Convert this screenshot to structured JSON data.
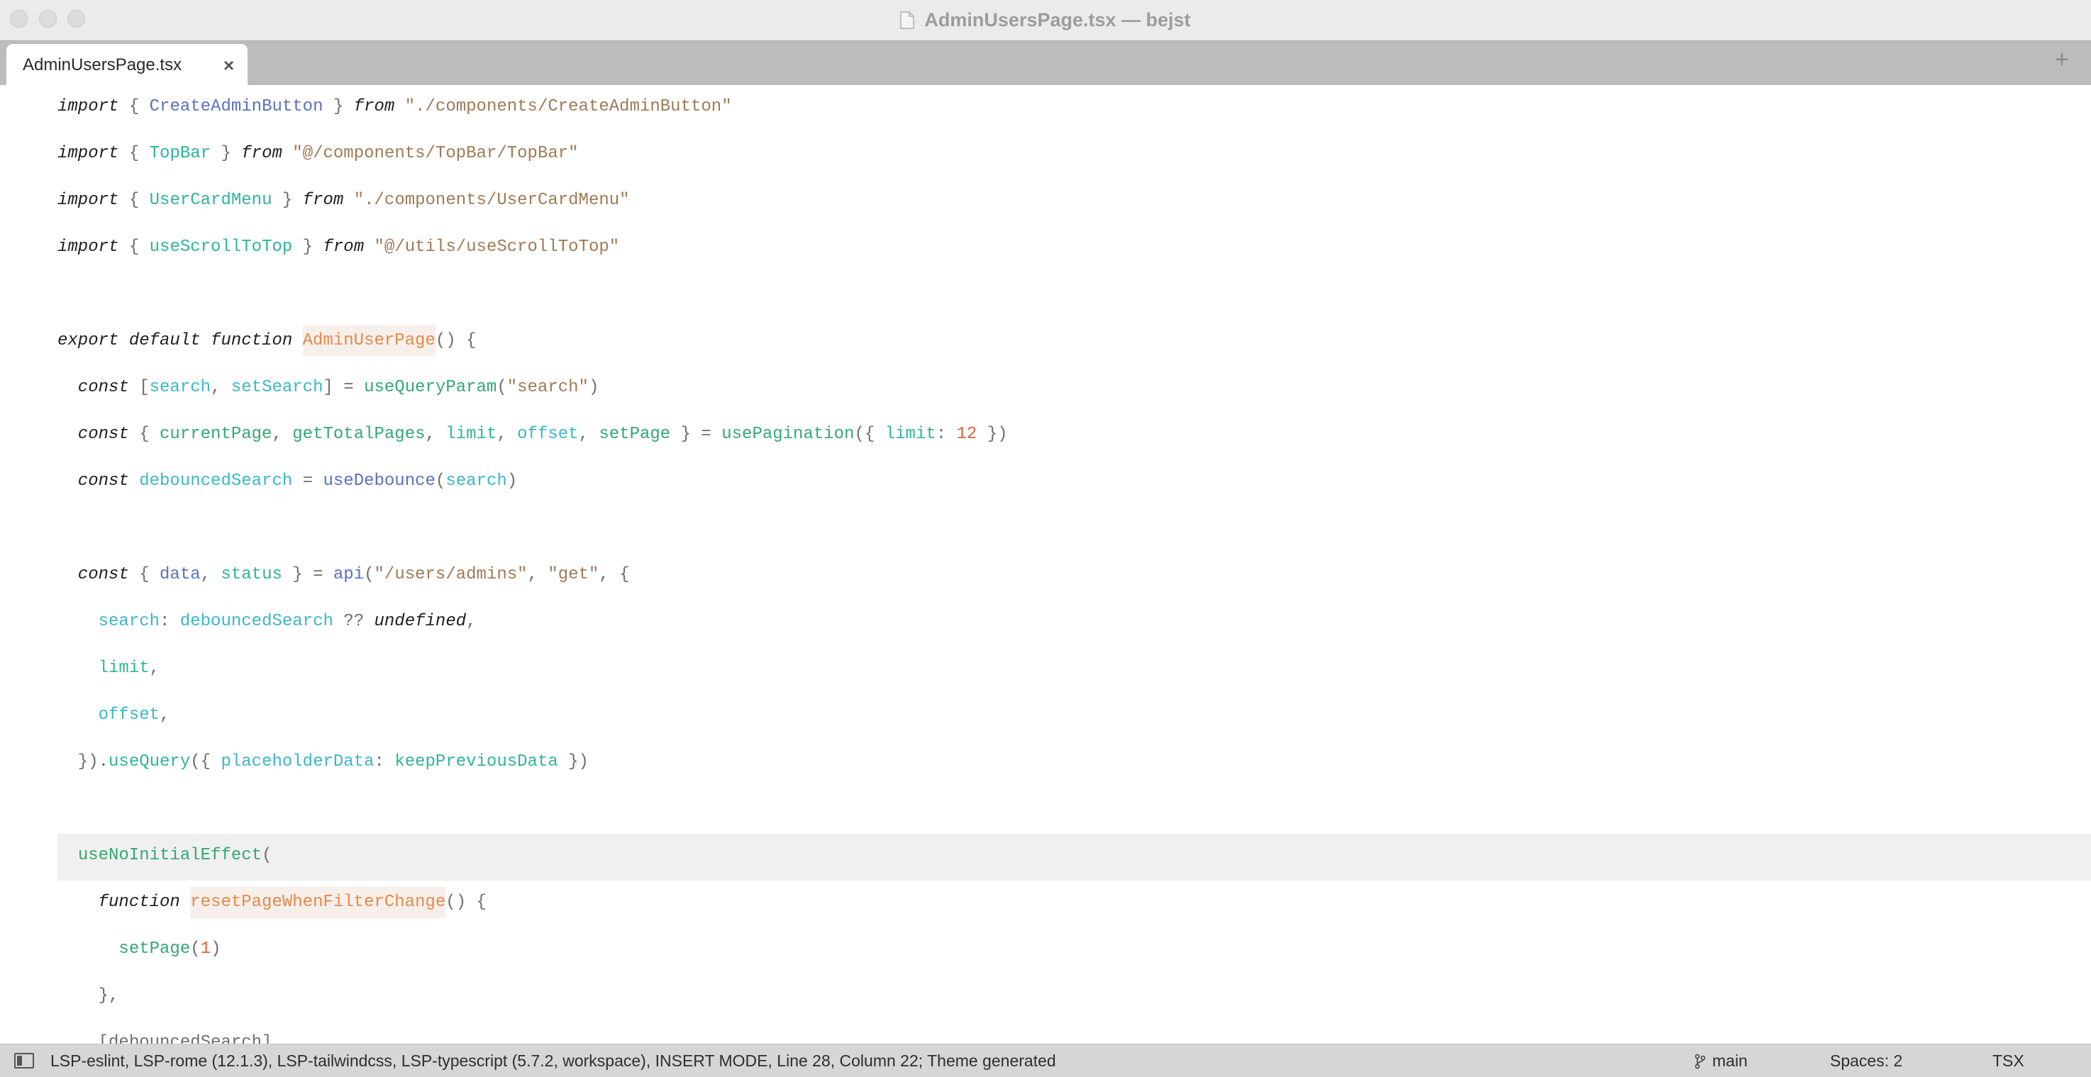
{
  "window": {
    "title": "AdminUsersPage.tsx — bejst"
  },
  "tabs": [
    {
      "label": "AdminUsersPage.tsx",
      "close": "×"
    }
  ],
  "add_tab": "+",
  "code_lines": [
    {
      "tokens": [
        [
          "kw",
          "import"
        ],
        [
          "p",
          " { "
        ],
        [
          "b",
          "CreateAdminButton"
        ],
        [
          "p",
          " } "
        ],
        [
          "kw",
          "from"
        ],
        [
          "p",
          " "
        ],
        [
          "str",
          "\"./components/CreateAdminButton\""
        ]
      ]
    },
    {
      "tokens": [
        [
          "kw",
          "import"
        ],
        [
          "p",
          " { "
        ],
        [
          "t",
          "TopBar"
        ],
        [
          "p",
          " } "
        ],
        [
          "kw",
          "from"
        ],
        [
          "p",
          " "
        ],
        [
          "str",
          "\"@/components/TopBar/TopBar\""
        ]
      ]
    },
    {
      "tokens": [
        [
          "kw",
          "import"
        ],
        [
          "p",
          " { "
        ],
        [
          "t",
          "UserCardMenu"
        ],
        [
          "p",
          " } "
        ],
        [
          "kw",
          "from"
        ],
        [
          "p",
          " "
        ],
        [
          "str",
          "\"./components/UserCardMenu\""
        ]
      ]
    },
    {
      "tokens": [
        [
          "kw",
          "import"
        ],
        [
          "p",
          " { "
        ],
        [
          "t",
          "useScrollToTop"
        ],
        [
          "p",
          " } "
        ],
        [
          "kw",
          "from"
        ],
        [
          "p",
          " "
        ],
        [
          "str",
          "\"@/utils/useScrollToTop\""
        ]
      ]
    },
    {
      "tokens": []
    },
    {
      "tokens": [
        [
          "kw",
          "export default function "
        ],
        [
          "fn",
          "AdminUserPage"
        ],
        [
          "p",
          "() {"
        ]
      ]
    },
    {
      "tokens": [
        [
          "kw",
          "  const "
        ],
        [
          "p",
          "["
        ],
        [
          "c",
          "search"
        ],
        [
          "p",
          ", "
        ],
        [
          "c",
          "setSearch"
        ],
        [
          "p",
          "] = "
        ],
        [
          "g",
          "useQueryParam"
        ],
        [
          "p",
          "("
        ],
        [
          "str",
          "\"search\""
        ],
        [
          "p",
          ")"
        ]
      ]
    },
    {
      "tokens": [
        [
          "kw",
          "  const "
        ],
        [
          "p",
          "{ "
        ],
        [
          "g",
          "currentPage"
        ],
        [
          "p",
          ", "
        ],
        [
          "g",
          "getTotalPages"
        ],
        [
          "p",
          ", "
        ],
        [
          "t",
          "limit"
        ],
        [
          "p",
          ", "
        ],
        [
          "c",
          "offset"
        ],
        [
          "p",
          ", "
        ],
        [
          "g",
          "setPage"
        ],
        [
          "p",
          " } = "
        ],
        [
          "g",
          "usePagination"
        ],
        [
          "p",
          "({ "
        ],
        [
          "t",
          "limit"
        ],
        [
          "p",
          ": "
        ],
        [
          "num",
          "12"
        ],
        [
          "p",
          " })"
        ]
      ]
    },
    {
      "tokens": [
        [
          "kw",
          "  const "
        ],
        [
          "c",
          "debouncedSearch"
        ],
        [
          "p",
          " = "
        ],
        [
          "b",
          "useDebounce"
        ],
        [
          "p",
          "("
        ],
        [
          "c",
          "search"
        ],
        [
          "p",
          ")"
        ]
      ]
    },
    {
      "tokens": []
    },
    {
      "tokens": [
        [
          "kw",
          "  const "
        ],
        [
          "p",
          "{ "
        ],
        [
          "b",
          "data"
        ],
        [
          "p",
          ", "
        ],
        [
          "t",
          "status"
        ],
        [
          "p",
          " } = "
        ],
        [
          "b",
          "api"
        ],
        [
          "p",
          "("
        ],
        [
          "str",
          "\"/users/admins\""
        ],
        [
          "p",
          ", "
        ],
        [
          "str",
          "\"get\""
        ],
        [
          "p",
          ", {"
        ]
      ]
    },
    {
      "tokens": [
        [
          "p",
          "    "
        ],
        [
          "c",
          "search"
        ],
        [
          "p",
          ": "
        ],
        [
          "c",
          "debouncedSearch"
        ],
        [
          "p",
          " ?? "
        ],
        [
          "kw",
          "undefined"
        ],
        [
          "p",
          ","
        ]
      ]
    },
    {
      "tokens": [
        [
          "p",
          "    "
        ],
        [
          "t",
          "limit"
        ],
        [
          "p",
          ","
        ]
      ]
    },
    {
      "tokens": [
        [
          "p",
          "    "
        ],
        [
          "c",
          "offset"
        ],
        [
          "p",
          ","
        ]
      ]
    },
    {
      "tokens": [
        [
          "p",
          "  })."
        ],
        [
          "t",
          "useQuery"
        ],
        [
          "p",
          "({ "
        ],
        [
          "c",
          "placeholderData"
        ],
        [
          "p",
          ": "
        ],
        [
          "t",
          "keepPreviousData"
        ],
        [
          "p",
          " })"
        ]
      ]
    },
    {
      "tokens": []
    },
    {
      "tokens": [
        [
          "p",
          "  "
        ],
        [
          "g",
          "useNoInitialEffect"
        ],
        [
          "p",
          "("
        ]
      ],
      "current": true
    },
    {
      "tokens": [
        [
          "kw",
          "    function "
        ],
        [
          "fn",
          "resetPageWhenFilterChange"
        ],
        [
          "p",
          "() {"
        ]
      ]
    },
    {
      "tokens": [
        [
          "p",
          "      "
        ],
        [
          "g",
          "setPage"
        ],
        [
          "p",
          "("
        ],
        [
          "num",
          "1"
        ],
        [
          "p",
          ")"
        ]
      ]
    },
    {
      "tokens": [
        [
          "p",
          "    },"
        ]
      ]
    },
    {
      "tokens": [
        [
          "p",
          "    [debouncedSearch],"
        ]
      ]
    }
  ],
  "status_bar": {
    "text": "LSP-eslint, LSP-rome (12.1.3), LSP-tailwindcss, LSP-typescript (5.7.2, workspace), INSERT MODE, Line 28, Column 22; Theme generated",
    "branch": "main",
    "spaces": "Spaces: 2",
    "syntax": "TSX"
  }
}
